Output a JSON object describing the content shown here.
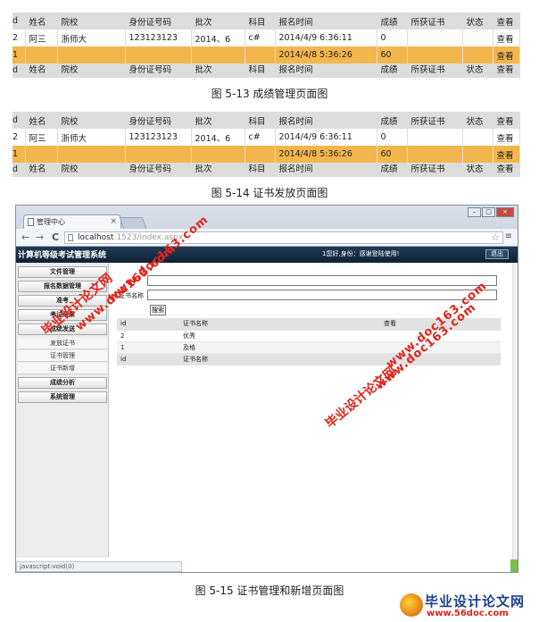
{
  "table_headers": [
    "d",
    "姓名",
    "院校",
    "身份证号码",
    "批次",
    "科目",
    "报名时间",
    "成绩",
    "所获证书",
    "状态",
    "查看"
  ],
  "table_row1": [
    "2",
    "阿三",
    "浙师大",
    "123123123",
    "2014、6",
    "c#",
    "2014/4/9 6:36:11",
    "0",
    "",
    "",
    "查看"
  ],
  "table_row2": [
    "1",
    "",
    "",
    "",
    "",
    "",
    "2014/4/8 5:36:26",
    "60",
    "",
    "",
    "查看"
  ],
  "captions": {
    "fig13": "图 5-13 成绩管理页面图",
    "fig14": "图 5-14 证书发放页面图",
    "fig15": "图 5-15 证书管理和新增页面图"
  },
  "browser": {
    "tab_title": "管理中心",
    "tab_close": "×",
    "nav_back": "←",
    "nav_forward": "→",
    "nav_reload": "C",
    "url_host": "localhost",
    "url_path": ":1523/index.aspx",
    "star": "☆",
    "menu": "≡",
    "win_min": "–",
    "win_max": "□",
    "win_close": "×",
    "status_text": "javascript:void(0)"
  },
  "app": {
    "title": "计算机等级考试管理系统",
    "welcome": "1您好,身份：感谢登陆使用!",
    "logout": "退出",
    "sidebar": [
      {
        "label": "文件管理",
        "type": "item"
      },
      {
        "label": "报名数据管理",
        "type": "item"
      },
      {
        "label": "准考",
        "type": "item"
      },
      {
        "label": "考试结果",
        "type": "item"
      },
      {
        "label": "成绩发送",
        "type": "item"
      },
      {
        "label": "发放证书",
        "type": "sub"
      },
      {
        "label": "证书管理",
        "type": "sub"
      },
      {
        "label": "证书新增",
        "type": "sub"
      },
      {
        "label": "成绩分析",
        "type": "item"
      },
      {
        "label": "系统管理",
        "type": "item"
      }
    ],
    "form": {
      "cert_label": "证书名称",
      "search_button": "搜索"
    },
    "grid_headers": [
      "id",
      "证书名称",
      "查看"
    ],
    "grid_rows": [
      [
        "2",
        "优秀",
        ""
      ],
      [
        "1",
        "及格",
        ""
      ]
    ],
    "grid_footer": [
      "id",
      "证书名称",
      ""
    ]
  },
  "watermarks": {
    "cn": "毕业设计论文网",
    "url": "www.doc163.com"
  },
  "footer": {
    "name": "毕业设计论文网",
    "url": "www.56doc.com"
  }
}
